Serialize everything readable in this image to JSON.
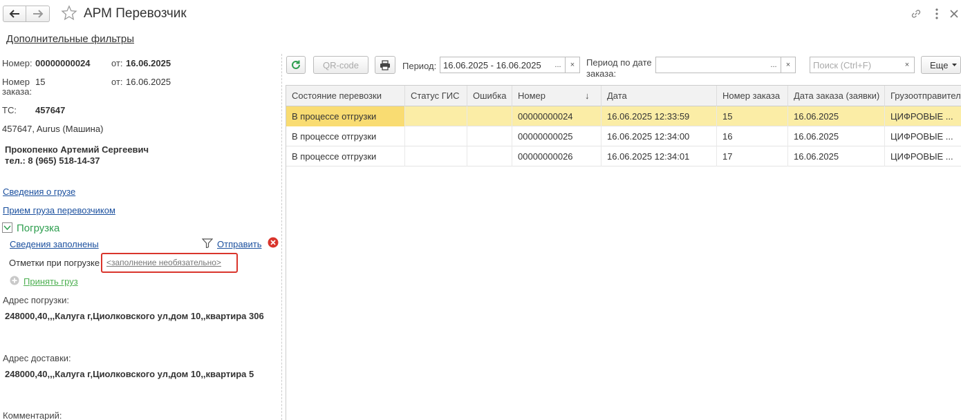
{
  "header": {
    "title": "АРМ Перевозчик",
    "filters_link": "Дополнительные фильтры"
  },
  "left": {
    "number_label": "Номер:",
    "number_value": "00000000024",
    "from1_label": "от:",
    "from1_value": "16.06.2025",
    "order_label_1": "Номер",
    "order_label_2": "заказа:",
    "order_value": "15",
    "from2_label": "от:",
    "from2_value": "16.06.2025",
    "ts_label": "ТС:",
    "ts_value": "457647",
    "vehicle": "457647, Aurus (Машина)",
    "driver_name": "Прокопенко Артемий Сергеевич",
    "driver_phone": "тел.: 8 (965) 518-14-37",
    "cargo_info_link": "Сведения о грузе",
    "cargo_accept_link": "Прием груза перевозчиком",
    "loading_section": "Погрузка",
    "info_filled_link": "Сведения заполнены",
    "send_link": "Отправить",
    "marks_label": "Отметки при погрузке",
    "marks_value": "<заполнение необязательно>",
    "accept_cargo_link": "Принять груз",
    "loading_address_label": "Адрес погрузки:",
    "loading_address": "248000,40,,,Калуга г,Циолковского ул,дом 10,,квартира 306",
    "delivery_address_label": "Адрес доставки:",
    "delivery_address": "248000,40,,,Калуга г,Циолковского ул,дом 10,,квартира 5",
    "comment_label": "Комментарий:"
  },
  "toolbar": {
    "qr_label": "QR-code",
    "period_label": "Период:",
    "period_value": "16.06.2025 - 16.06.2025",
    "dots": "...",
    "clear": "×",
    "order_period_label_1": "Период по дате",
    "order_period_label_2": "заказа:",
    "order_period_value": "",
    "search_placeholder": "Поиск (Ctrl+F)",
    "more_label": "Еще"
  },
  "table": {
    "columns": [
      "Состояние перевозки",
      "Статус ГИС",
      "Ошибка",
      "Номер",
      "Дата",
      "Номер заказа",
      "Дата заказа (заявки)",
      "Грузоотправитель"
    ],
    "rows": [
      [
        "В процессе отгрузки",
        "",
        "",
        "00000000024",
        "16.06.2025 12:33:59",
        "15",
        "16.06.2025",
        "ЦИФРОВЫЕ ..."
      ],
      [
        "В процессе отгрузки",
        "",
        "",
        "00000000025",
        "16.06.2025 12:34:00",
        "16",
        "16.06.2025",
        "ЦИФРОВЫЕ ..."
      ],
      [
        "В процессе отгрузки",
        "",
        "",
        "00000000026",
        "16.06.2025 12:34:01",
        "17",
        "16.06.2025",
        "ЦИФРОВЫЕ ..."
      ]
    ],
    "selected_row": 0,
    "sort_indicator": "↓"
  },
  "colors": {
    "accent_green": "#2e9e4f",
    "link_blue": "#1a4f9e",
    "selected_row": "#fbeda6",
    "highlight_red": "#d9342b"
  }
}
